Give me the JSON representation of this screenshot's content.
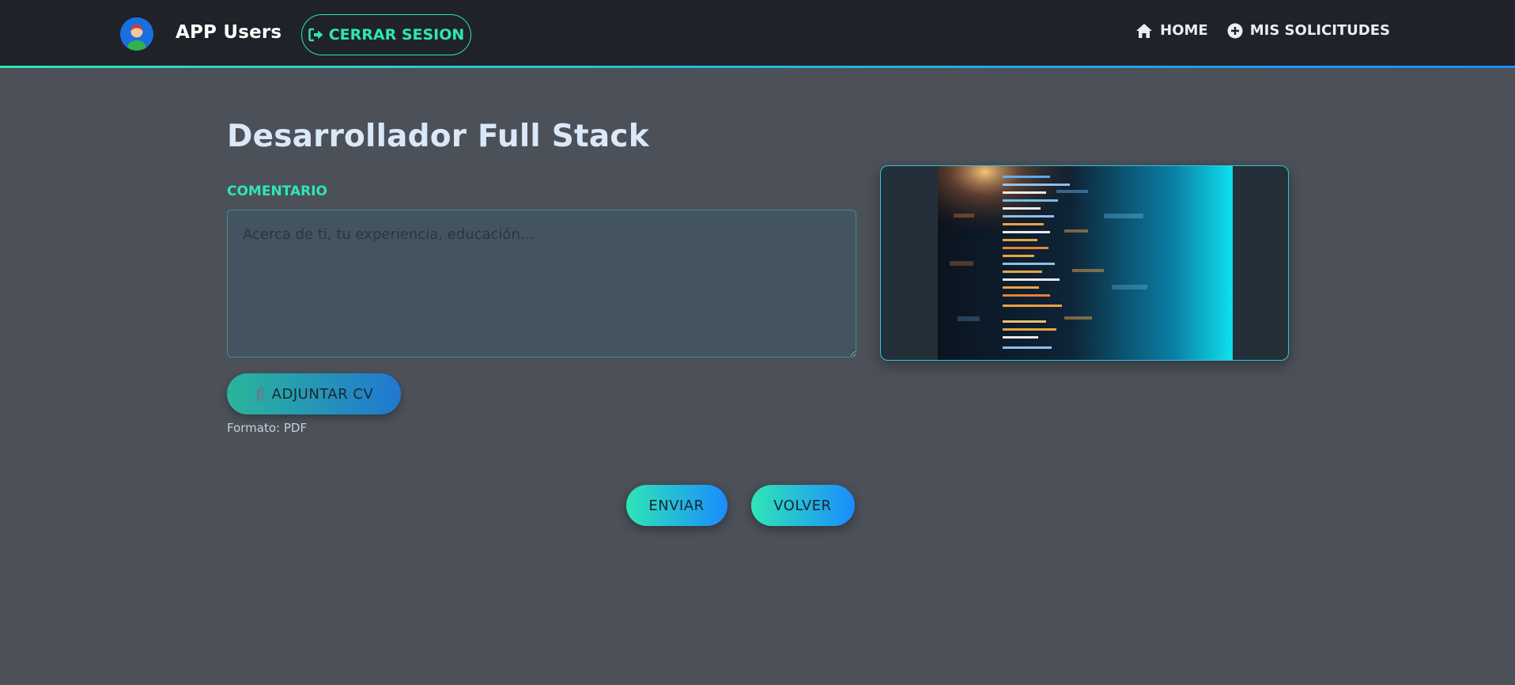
{
  "navbar": {
    "brand_title": "APP Users",
    "logout_label": "CERRAR SESION",
    "links": [
      {
        "label": "HOME",
        "icon": "home-icon"
      },
      {
        "label": "MIS SOLICITUDES",
        "icon": "plus-circle-icon"
      }
    ]
  },
  "main": {
    "title": "Desarrollador Full Stack",
    "comment_label": "COMENTARIO",
    "comment_value": "",
    "comment_placeholder": "Acerca de ti, tu experiencia, educación...",
    "attach_label": "ADJUNTAR CV",
    "attach_icon": "paperclip-icon",
    "format_hint": "Formato: PDF",
    "image": {
      "description_icon": "code-screen-image"
    }
  },
  "actions": {
    "send_label": "ENVIAR",
    "back_label": "VOLVER"
  },
  "colors": {
    "accent": "#2ee6b6",
    "accent_end": "#1a8cff",
    "background": "#4b5059",
    "navbar": "#1f2228",
    "title": "#dbe8f8"
  }
}
